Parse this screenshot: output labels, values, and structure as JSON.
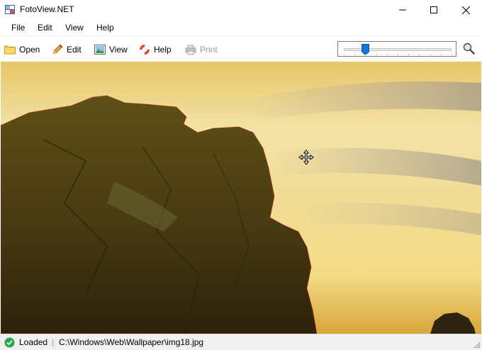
{
  "window": {
    "title": "FotoView.NET"
  },
  "menu": {
    "items": [
      "File",
      "Edit",
      "View",
      "Help"
    ]
  },
  "toolbar": {
    "open_label": "Open",
    "edit_label": "Edit",
    "view_label": "View",
    "help_label": "Help",
    "print_label": "Print",
    "print_enabled": false
  },
  "zoom": {
    "slider_fraction": 0.2,
    "icon": "magnifier-icon"
  },
  "image": {
    "description_icon": "move-cursor-icon"
  },
  "status": {
    "state": "Loaded",
    "separator": "|",
    "path": "C:\\Windows\\Web\\Wallpaper\\img18.jpg",
    "state_color": "#2aa84a"
  }
}
